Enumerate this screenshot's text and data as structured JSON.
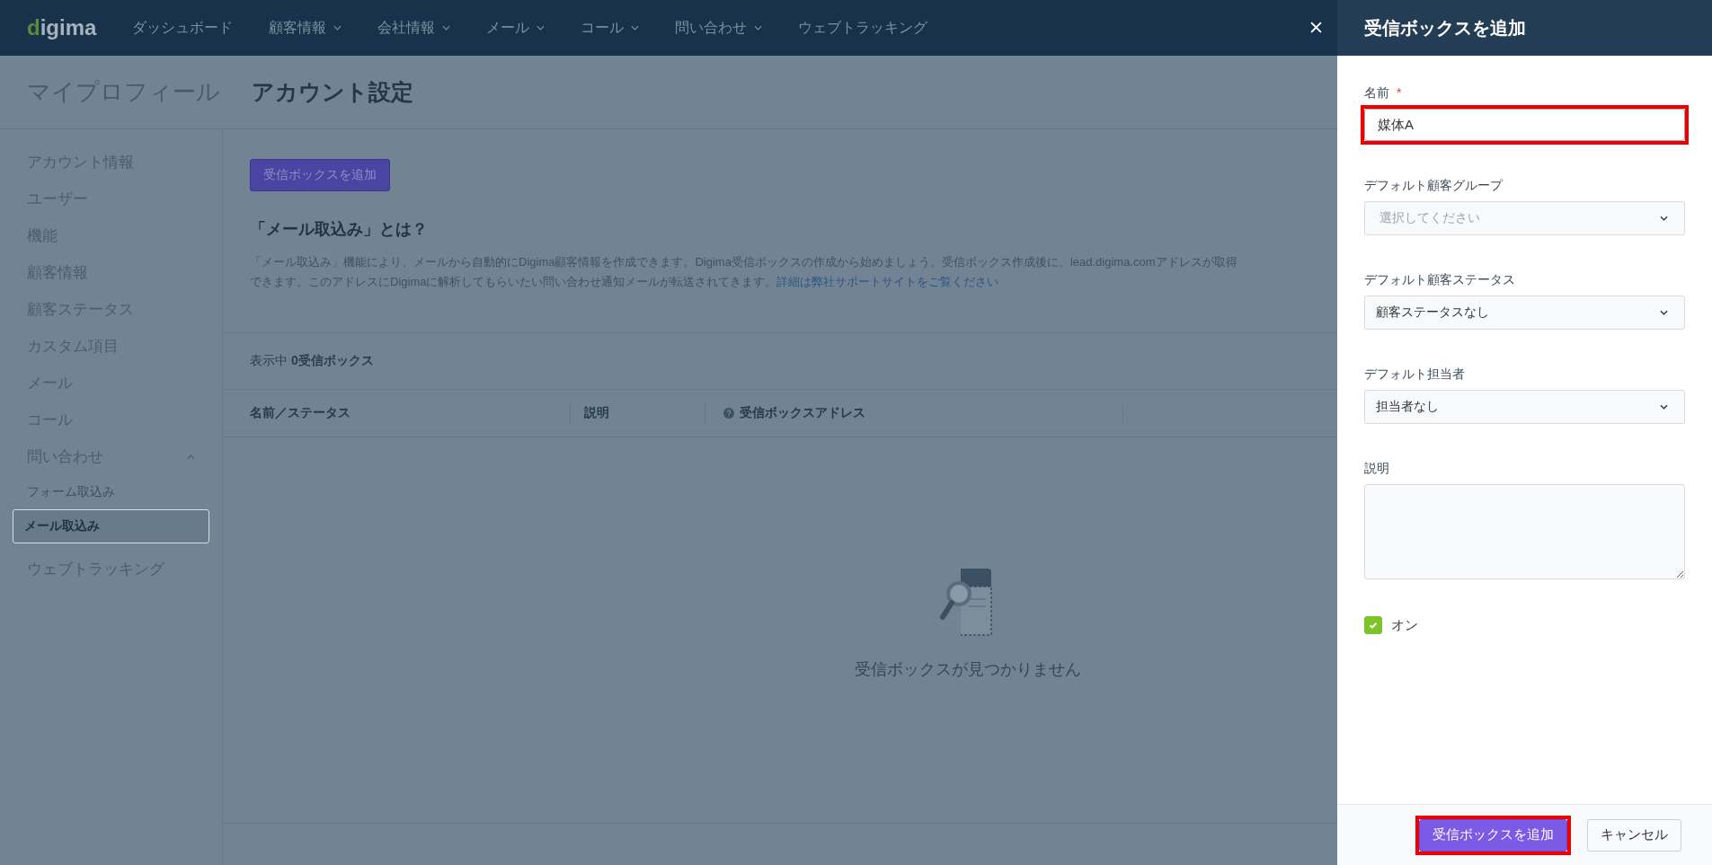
{
  "top_nav": {
    "logo": "digima",
    "items": [
      {
        "label": "ダッシュボード",
        "has_menu": false
      },
      {
        "label": "顧客情報",
        "has_menu": true
      },
      {
        "label": "会社情報",
        "has_menu": true
      },
      {
        "label": "メール",
        "has_menu": true
      },
      {
        "label": "コール",
        "has_menu": true
      },
      {
        "label": "問い合わせ",
        "has_menu": true
      },
      {
        "label": "ウェブトラッキング",
        "has_menu": false
      }
    ]
  },
  "page": {
    "section_title": "マイプロフィール",
    "heading": "アカウント設定"
  },
  "sidebar": {
    "items": [
      {
        "label": "アカウント情報",
        "selected": false
      },
      {
        "label": "ユーザー",
        "selected": false
      },
      {
        "label": "機能",
        "selected": false
      },
      {
        "label": "顧客情報",
        "selected": false
      },
      {
        "label": "顧客ステータス",
        "selected": false
      },
      {
        "label": "カスタム項目",
        "selected": false
      },
      {
        "label": "メール",
        "selected": false
      },
      {
        "label": "コール",
        "selected": false
      },
      {
        "label": "問い合わせ",
        "selected": false,
        "expanded": true,
        "children": [
          {
            "label": "フォーム取込み",
            "selected": false
          },
          {
            "label": "メール取込み",
            "selected": true
          }
        ]
      },
      {
        "label": "ウェブトラッキング",
        "selected": false
      }
    ]
  },
  "content": {
    "add_button": "受信ボックスを追加",
    "intro": {
      "title": "「メール取込み」とは？",
      "text": "「メール取込み」機能により、メールから自動的にDigima顧客情報を作成できます。Digima受信ボックスの作成から始めましょう。受信ボックス作成後に、lead.digima.comアドレスが取得できます。このアドレスにDigimaに解析してもらいたい問い合わせ通知メールが転送されてきます。",
      "link": "詳細は弊社サポートサイトをご覧ください"
    },
    "count": "表示中 **0受信ボックス**",
    "table": {
      "columns": [
        {
          "label": "名前／ステータス",
          "help": false
        },
        {
          "label": "説明",
          "help": false
        },
        {
          "label": "受信ボックスアドレス",
          "help": true
        }
      ]
    },
    "empty_state": {
      "message": "受信ボックスが見つかりません"
    }
  },
  "panel": {
    "title": "受信ボックスを追加",
    "fields": [
      {
        "kind": "text",
        "label": "名前",
        "required_mark": "*",
        "value": "媒体A",
        "highlighted": true
      },
      {
        "kind": "select",
        "label": "デフォルト顧客グループ",
        "placeholder": "選択してください"
      },
      {
        "kind": "select",
        "label": "デフォルト顧客ステータス",
        "value": "顧客ステータスなし"
      },
      {
        "kind": "select",
        "label": "デフォルト担当者",
        "value": "担当者なし"
      },
      {
        "kind": "textarea",
        "label": "説明"
      }
    ],
    "toggle": {
      "label": "オン",
      "checked": true
    },
    "buttons": [
      {
        "label": "受信ボックスを追加",
        "kind": "primary",
        "highlighted": true
      },
      {
        "label": "キャンセル",
        "kind": "secondary",
        "highlighted": false
      }
    ]
  }
}
